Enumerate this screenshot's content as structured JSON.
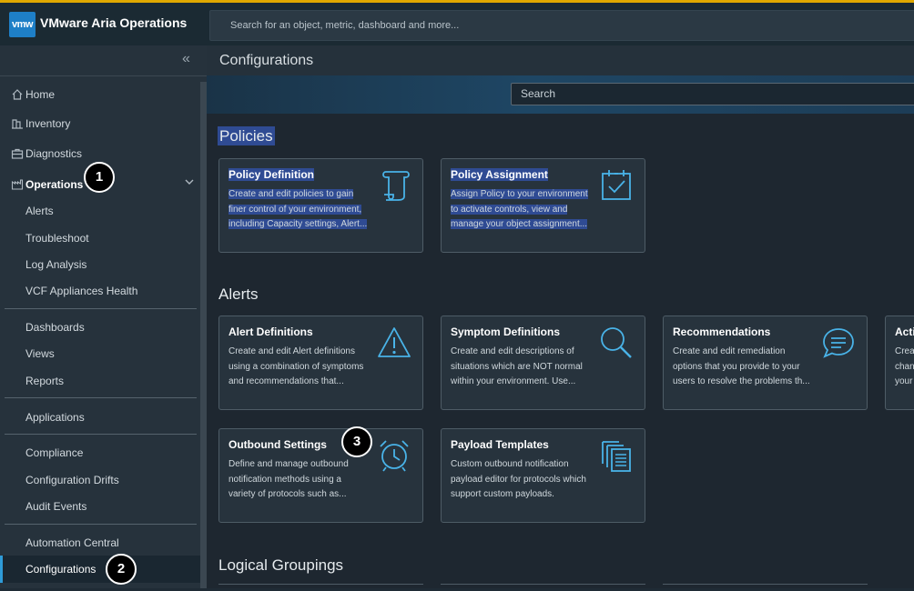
{
  "topbar": {
    "logo": "vmw",
    "app_title": "VMware Aria Operations",
    "search_placeholder": "Search for an object, metric, dashboard and more..."
  },
  "sidebar": {
    "collapse_icon": "double-chevron-left-icon",
    "items": [
      {
        "label": "Home",
        "icon": "home-icon"
      },
      {
        "label": "Inventory",
        "icon": "inventory-icon"
      },
      {
        "label": "Diagnostics",
        "icon": "diagnostics-icon"
      },
      {
        "label": "Operations",
        "icon": "operations-icon"
      },
      {
        "label": "Alerts"
      },
      {
        "label": "Troubleshoot"
      },
      {
        "label": "Log Analysis"
      },
      {
        "label": "VCF Appliances Health"
      },
      {
        "label": "Dashboards"
      },
      {
        "label": "Views"
      },
      {
        "label": "Reports"
      },
      {
        "label": "Applications"
      },
      {
        "label": "Compliance"
      },
      {
        "label": "Configuration Drifts"
      },
      {
        "label": "Audit Events"
      },
      {
        "label": "Automation Central"
      },
      {
        "label": "Configurations"
      }
    ]
  },
  "badges": [
    "1",
    "2",
    "3"
  ],
  "main": {
    "page_title": "Configurations",
    "search_placeholder": "Search",
    "sections": [
      {
        "title": "Policies",
        "cards": [
          {
            "title": "Policy Definition",
            "desc": [
              "Create and edit policies to gain",
              "finer control of your environment,",
              "including Capacity settings, Alert..."
            ],
            "icon": "scroll-icon"
          },
          {
            "title": "Policy Assignment",
            "desc": [
              "Assign Policy to your environment",
              "to activate controls, view and",
              "manage your object assignment..."
            ],
            "icon": "calendar-check-icon"
          }
        ]
      },
      {
        "title": "Alerts",
        "cards": [
          {
            "title": "Alert Definitions",
            "desc": [
              "Create and edit Alert definitions",
              "using a combination of symptoms",
              "and recommendations that..."
            ],
            "icon": "warning-triangle-icon"
          },
          {
            "title": "Symptom Definitions",
            "desc": [
              "Create and edit descriptions of",
              "situations which are NOT normal",
              "within your environment. Use..."
            ],
            "icon": "magnifier-icon"
          },
          {
            "title": "Recommendations",
            "desc": [
              "Create and edit remediation",
              "options that you provide to your",
              "users to resolve the problems th..."
            ],
            "icon": "chat-bubble-icon"
          },
          {
            "title": "Acti",
            "desc": [
              "Crea",
              "chan",
              "your"
            ],
            "icon": ""
          },
          {
            "title": "Outbound Settings",
            "desc": [
              "Define and manage outbound",
              "notification methods using a",
              "variety of protocols such as..."
            ],
            "icon": "alarm-clock-icon"
          },
          {
            "title": "Payload Templates",
            "desc": [
              "Custom outbound notification",
              "payload editor for protocols which",
              "support custom payloads."
            ],
            "icon": "documents-icon"
          }
        ]
      },
      {
        "title": "Logical Groupings",
        "cards": []
      }
    ]
  }
}
